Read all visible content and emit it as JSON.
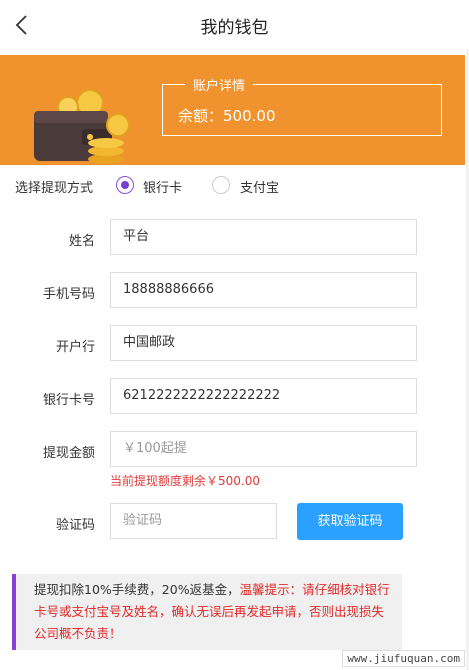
{
  "header": {
    "title": "我的钱包"
  },
  "account": {
    "title": "账户详情",
    "balance_text": "余额：500.00"
  },
  "method": {
    "label": "选择提现方式",
    "options": [
      {
        "label": "银行卡",
        "selected": true
      },
      {
        "label": "支付宝",
        "selected": false
      }
    ]
  },
  "form": {
    "name_label": "姓名",
    "name_value": "平台",
    "phone_label": "手机号码",
    "phone_value": "18888886666",
    "bank_label": "开户行",
    "bank_value": "中国邮政",
    "card_label": "银行卡号",
    "card_value": "6212222222222222222",
    "amount_label": "提现金额",
    "amount_placeholder": "￥100起提",
    "amount_hint": "当前提现额度剩余￥500.00",
    "code_label": "验证码",
    "code_placeholder": "验证码",
    "code_button": "获取验证码"
  },
  "notice": {
    "normal": "提现扣除10%手续费，20%返基金，",
    "warning": "温馨提示：请仔细核对银行卡号或支付宝号及姓名，确认无误后再发起申请，否则出现损失公司概不负责！"
  },
  "watermark": "www.jiufuquan.com",
  "colors": {
    "banner": "#f0922e",
    "accent": "#7a3fd0",
    "button": "#2aa0ff",
    "warning": "#e02a2a"
  }
}
